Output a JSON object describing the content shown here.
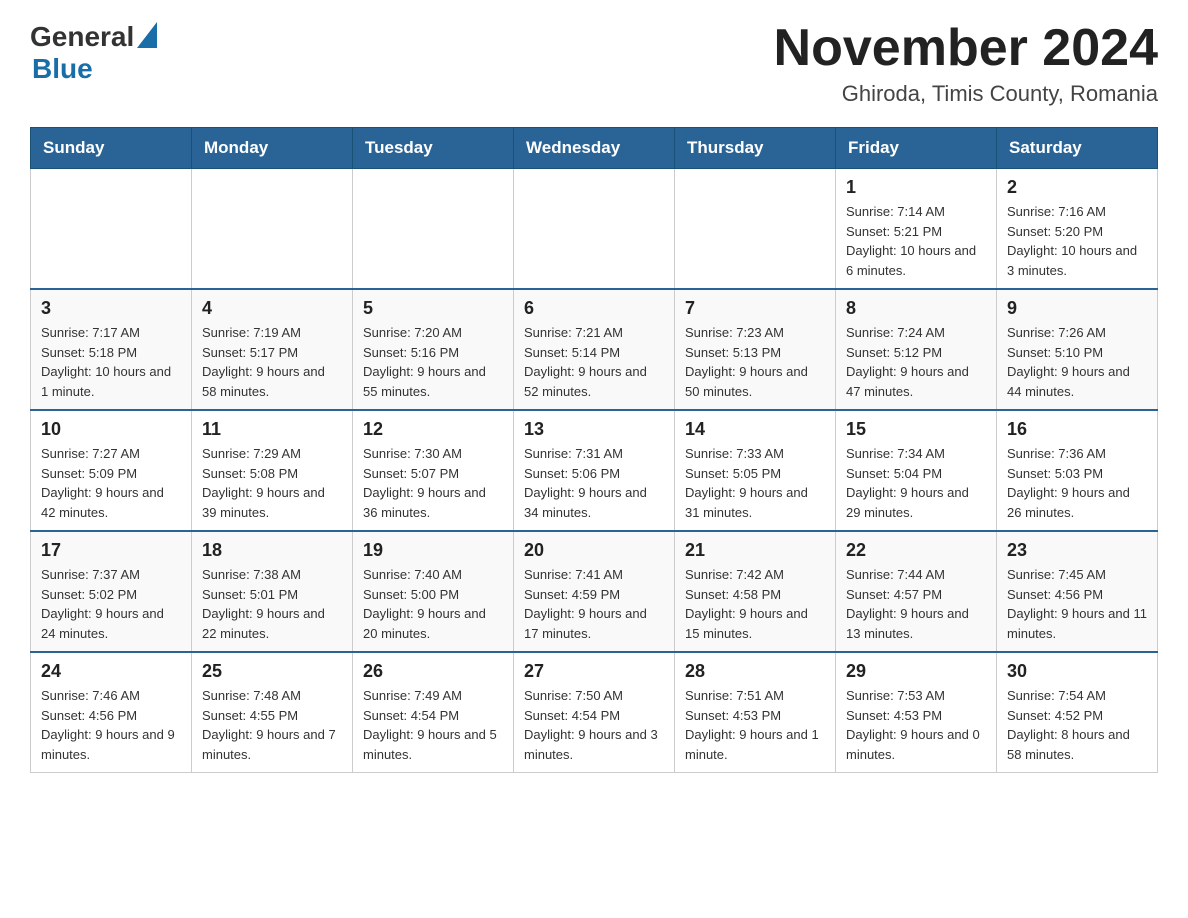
{
  "header": {
    "logo_general": "General",
    "logo_blue": "Blue",
    "month_title": "November 2024",
    "location": "Ghiroda, Timis County, Romania"
  },
  "weekdays": [
    "Sunday",
    "Monday",
    "Tuesday",
    "Wednesday",
    "Thursday",
    "Friday",
    "Saturday"
  ],
  "weeks": [
    [
      {
        "day": "",
        "info": ""
      },
      {
        "day": "",
        "info": ""
      },
      {
        "day": "",
        "info": ""
      },
      {
        "day": "",
        "info": ""
      },
      {
        "day": "",
        "info": ""
      },
      {
        "day": "1",
        "info": "Sunrise: 7:14 AM\nSunset: 5:21 PM\nDaylight: 10 hours and 6 minutes."
      },
      {
        "day": "2",
        "info": "Sunrise: 7:16 AM\nSunset: 5:20 PM\nDaylight: 10 hours and 3 minutes."
      }
    ],
    [
      {
        "day": "3",
        "info": "Sunrise: 7:17 AM\nSunset: 5:18 PM\nDaylight: 10 hours and 1 minute."
      },
      {
        "day": "4",
        "info": "Sunrise: 7:19 AM\nSunset: 5:17 PM\nDaylight: 9 hours and 58 minutes."
      },
      {
        "day": "5",
        "info": "Sunrise: 7:20 AM\nSunset: 5:16 PM\nDaylight: 9 hours and 55 minutes."
      },
      {
        "day": "6",
        "info": "Sunrise: 7:21 AM\nSunset: 5:14 PM\nDaylight: 9 hours and 52 minutes."
      },
      {
        "day": "7",
        "info": "Sunrise: 7:23 AM\nSunset: 5:13 PM\nDaylight: 9 hours and 50 minutes."
      },
      {
        "day": "8",
        "info": "Sunrise: 7:24 AM\nSunset: 5:12 PM\nDaylight: 9 hours and 47 minutes."
      },
      {
        "day": "9",
        "info": "Sunrise: 7:26 AM\nSunset: 5:10 PM\nDaylight: 9 hours and 44 minutes."
      }
    ],
    [
      {
        "day": "10",
        "info": "Sunrise: 7:27 AM\nSunset: 5:09 PM\nDaylight: 9 hours and 42 minutes."
      },
      {
        "day": "11",
        "info": "Sunrise: 7:29 AM\nSunset: 5:08 PM\nDaylight: 9 hours and 39 minutes."
      },
      {
        "day": "12",
        "info": "Sunrise: 7:30 AM\nSunset: 5:07 PM\nDaylight: 9 hours and 36 minutes."
      },
      {
        "day": "13",
        "info": "Sunrise: 7:31 AM\nSunset: 5:06 PM\nDaylight: 9 hours and 34 minutes."
      },
      {
        "day": "14",
        "info": "Sunrise: 7:33 AM\nSunset: 5:05 PM\nDaylight: 9 hours and 31 minutes."
      },
      {
        "day": "15",
        "info": "Sunrise: 7:34 AM\nSunset: 5:04 PM\nDaylight: 9 hours and 29 minutes."
      },
      {
        "day": "16",
        "info": "Sunrise: 7:36 AM\nSunset: 5:03 PM\nDaylight: 9 hours and 26 minutes."
      }
    ],
    [
      {
        "day": "17",
        "info": "Sunrise: 7:37 AM\nSunset: 5:02 PM\nDaylight: 9 hours and 24 minutes."
      },
      {
        "day": "18",
        "info": "Sunrise: 7:38 AM\nSunset: 5:01 PM\nDaylight: 9 hours and 22 minutes."
      },
      {
        "day": "19",
        "info": "Sunrise: 7:40 AM\nSunset: 5:00 PM\nDaylight: 9 hours and 20 minutes."
      },
      {
        "day": "20",
        "info": "Sunrise: 7:41 AM\nSunset: 4:59 PM\nDaylight: 9 hours and 17 minutes."
      },
      {
        "day": "21",
        "info": "Sunrise: 7:42 AM\nSunset: 4:58 PM\nDaylight: 9 hours and 15 minutes."
      },
      {
        "day": "22",
        "info": "Sunrise: 7:44 AM\nSunset: 4:57 PM\nDaylight: 9 hours and 13 minutes."
      },
      {
        "day": "23",
        "info": "Sunrise: 7:45 AM\nSunset: 4:56 PM\nDaylight: 9 hours and 11 minutes."
      }
    ],
    [
      {
        "day": "24",
        "info": "Sunrise: 7:46 AM\nSunset: 4:56 PM\nDaylight: 9 hours and 9 minutes."
      },
      {
        "day": "25",
        "info": "Sunrise: 7:48 AM\nSunset: 4:55 PM\nDaylight: 9 hours and 7 minutes."
      },
      {
        "day": "26",
        "info": "Sunrise: 7:49 AM\nSunset: 4:54 PM\nDaylight: 9 hours and 5 minutes."
      },
      {
        "day": "27",
        "info": "Sunrise: 7:50 AM\nSunset: 4:54 PM\nDaylight: 9 hours and 3 minutes."
      },
      {
        "day": "28",
        "info": "Sunrise: 7:51 AM\nSunset: 4:53 PM\nDaylight: 9 hours and 1 minute."
      },
      {
        "day": "29",
        "info": "Sunrise: 7:53 AM\nSunset: 4:53 PM\nDaylight: 9 hours and 0 minutes."
      },
      {
        "day": "30",
        "info": "Sunrise: 7:54 AM\nSunset: 4:52 PM\nDaylight: 8 hours and 58 minutes."
      }
    ]
  ]
}
